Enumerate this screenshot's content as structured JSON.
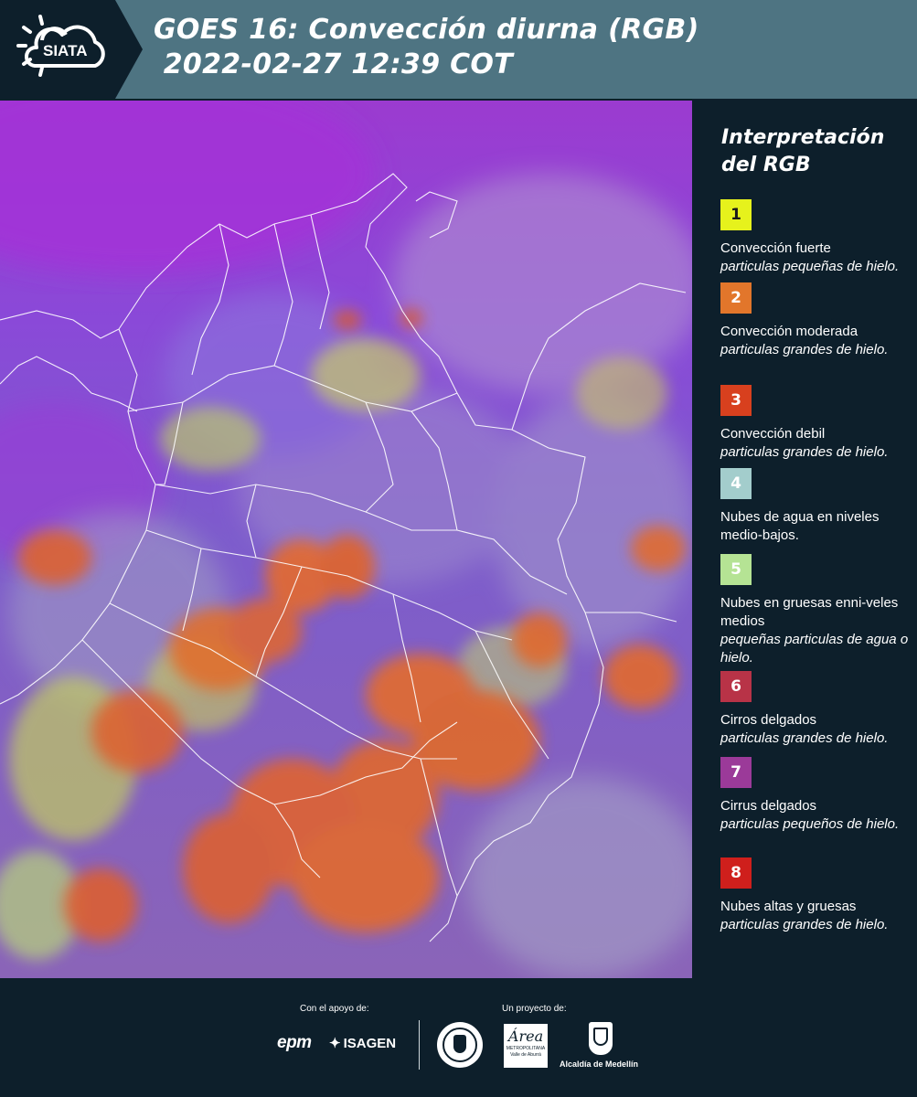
{
  "header": {
    "logo_text": "SIATA",
    "title_line1": "GOES 16: Convección diurna (RGB)",
    "title_line2": " 2022-02-27 12:39 COT"
  },
  "legend": {
    "title_line1": "Interpretación",
    "title_line2": "del RGB",
    "items": [
      {
        "number": "1",
        "color": "#e6f21c",
        "text_color": "#1a1a1a",
        "name": "Convección fuerte",
        "desc": "particulas pequeñas de hielo."
      },
      {
        "number": "2",
        "color": "#e2762b",
        "text_color": "#ffffff",
        "name": "Convección moderada",
        "desc": "particulas grandes de hielo."
      },
      {
        "number": "3",
        "color": "#d8401e",
        "text_color": "#ffffff",
        "name": "Convección debil",
        "desc": "particulas grandes de hielo."
      },
      {
        "number": "4",
        "color": "#a3cdcc",
        "text_color": "#ffffff",
        "name": "Nubes de agua en niveles medio-bajos.",
        "desc": ""
      },
      {
        "number": "5",
        "color": "#b5e394",
        "text_color": "#ffffff",
        "name": "Nubes en gruesas enni-veles medios",
        "desc": "pequeñas particulas de agua o hielo."
      },
      {
        "number": "6",
        "color": "#b83347",
        "text_color": "#ffffff",
        "name": "Cirros delgados",
        "desc": "particulas grandes de hielo."
      },
      {
        "number": "7",
        "color": "#9b3a99",
        "text_color": "#ffffff",
        "name": "Cirrus delgados",
        "desc": "particulas pequeños de hielo."
      },
      {
        "number": "8",
        "color": "#cf1f1c",
        "text_color": "#ffffff",
        "name": "Nubes altas y gruesas",
        "desc": "particulas grandes de hielo."
      }
    ]
  },
  "footer": {
    "support_label": "Con el apoyo de:",
    "project_label": "Un proyecto de:",
    "sponsor1": "epm",
    "sponsor2": "ISAGEN",
    "partner_area_line1": "Área",
    "partner_area_line2": "METROPOLITANA",
    "partner_area_line3": "Valle de Aburrá",
    "partner_alcaldia": "Alcaldía de Medellín"
  }
}
